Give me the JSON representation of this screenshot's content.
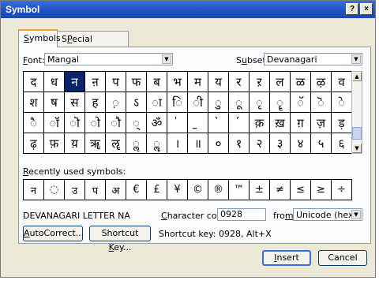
{
  "window": {
    "title": "Symbol",
    "help_glyph": "?",
    "close_glyph": "×"
  },
  "tabs": [
    {
      "label": "Symbols",
      "hotkey": "S",
      "rest": "ymbols"
    },
    {
      "label": "Special Characters",
      "hotkey": "P",
      "rest": "ecial Characters",
      "prefix": "S"
    }
  ],
  "font": {
    "label_hot": "F",
    "label_rest": "ont:",
    "value": "Mangal"
  },
  "subset": {
    "label_pre": "S",
    "label_hot": "u",
    "label_rest": "bset:",
    "value": "Devanagari"
  },
  "symbols_grid": [
    [
      "द",
      "ध",
      "न",
      "ऩ",
      "प",
      "फ",
      "ब",
      "भ",
      "म",
      "य",
      "र",
      "ऱ",
      "ल",
      "ळ",
      "ऴ",
      "व"
    ],
    [
      "श",
      "ष",
      "स",
      "ह",
      "◌़",
      "ऽ",
      "ा",
      "ि",
      "ी",
      "ु",
      "ू",
      "ृ",
      "ॄ",
      "ॅ",
      "ॆ",
      "े"
    ],
    [
      "ै",
      "ॉ",
      "ॊ",
      "ो",
      "ौ",
      "्",
      "ॐ",
      "॑",
      "॒",
      "॓",
      "॔",
      "क़",
      "ख़",
      "ग़",
      "ज़",
      "ड़"
    ],
    [
      "ढ़",
      "फ़",
      "य़",
      "ॠ",
      "ॡ",
      "ॢ",
      "ॣ",
      "।",
      "॥",
      "०",
      "१",
      "२",
      "३",
      "४",
      "५",
      "६"
    ]
  ],
  "selected_symbol": "न",
  "recent": {
    "label_hot": "R",
    "label_rest": "ecently used symbols:",
    "symbols": [
      "न",
      "◌",
      "उ",
      "प",
      "अ",
      "€",
      "£",
      "¥",
      "©",
      "®",
      "™",
      "±",
      "≠",
      "≤",
      "≥",
      "÷"
    ]
  },
  "char_name": "DEVANAGARI LETTER NA",
  "char_code": {
    "label_pre": "",
    "label_hot": "C",
    "label_rest": "haracter code:",
    "value": "0928"
  },
  "from": {
    "label_pre": "fro",
    "label_hot": "m",
    "label_rest": ":",
    "value": "Unicode (hex)"
  },
  "buttons": {
    "autocorrect": {
      "pre": "",
      "hot": "A",
      "rest": "utoCorrect..."
    },
    "shortcut_key": {
      "pre": "Shortcut ",
      "hot": "K",
      "rest": "ey..."
    },
    "insert": {
      "pre": "",
      "hot": "I",
      "rest": "nsert"
    },
    "cancel": "Cancel"
  },
  "shortcut_text": "Shortcut key: 0928, Alt+X",
  "icons": {
    "dropdown": "▼",
    "scroll_up": "▲",
    "scroll_down": "▼"
  }
}
